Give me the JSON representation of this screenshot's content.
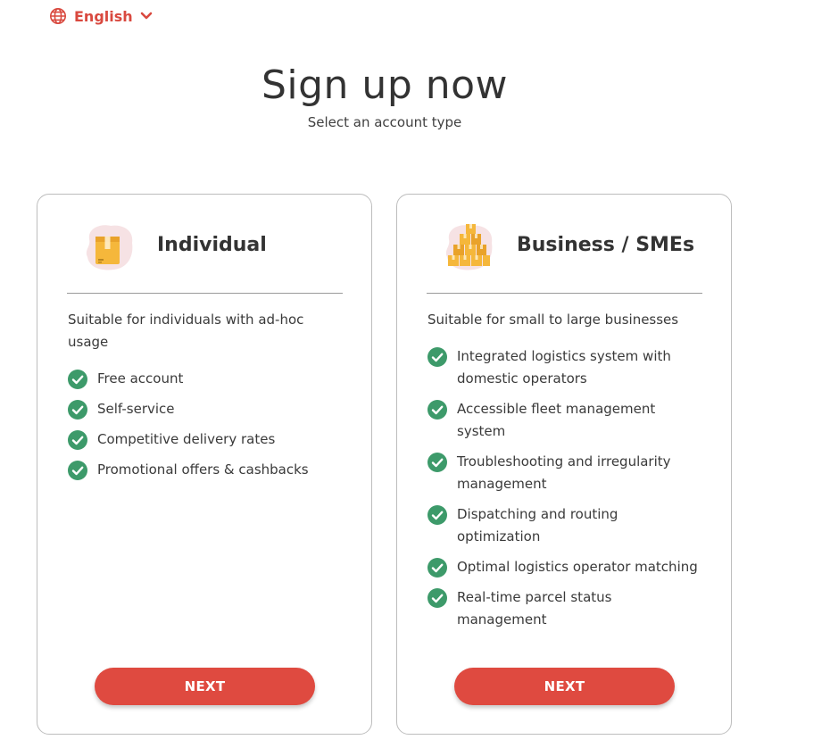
{
  "language": {
    "label": "English"
  },
  "header": {
    "title": "Sign up now",
    "subtitle": "Select an account type"
  },
  "colors": {
    "accent": "#df4a40",
    "check": "#3d9a6a",
    "text": "#333333"
  },
  "cards": [
    {
      "title": "Individual",
      "icon": "single-box-icon",
      "description": "Suitable for individuals with ad-hoc usage",
      "features": [
        "Free account",
        "Self-service",
        "Competitive delivery rates",
        "Promotional offers & cashbacks"
      ],
      "button_label": "NEXT"
    },
    {
      "title": "Business / SMEs",
      "icon": "stacked-boxes-icon",
      "description": "Suitable for small to large businesses",
      "features": [
        "Integrated logistics system with domestic operators",
        "Accessible fleet management system",
        "Troubleshooting and irregularity management",
        "Dispatching and routing optimization",
        "Optimal logistics operator matching",
        "Real-time parcel status management"
      ],
      "button_label": "NEXT"
    }
  ]
}
